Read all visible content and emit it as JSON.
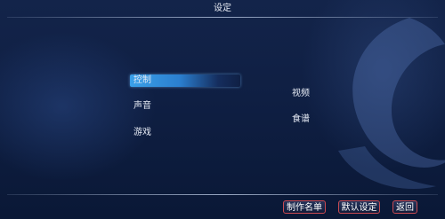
{
  "header": {
    "title": "设定"
  },
  "menu": {
    "left": [
      {
        "label": "控制",
        "selected": true
      },
      {
        "label": "声音",
        "selected": false
      },
      {
        "label": "游戏",
        "selected": false
      }
    ],
    "right": [
      {
        "label": "视频"
      },
      {
        "label": "食谱"
      }
    ]
  },
  "footer": {
    "credits_label": "制作名单",
    "defaults_label": "默认设定",
    "back_label": "返回"
  },
  "colors": {
    "selection_highlight": "#2b7fcf",
    "button_border": "#c94a52",
    "background": "#0f1f43"
  }
}
